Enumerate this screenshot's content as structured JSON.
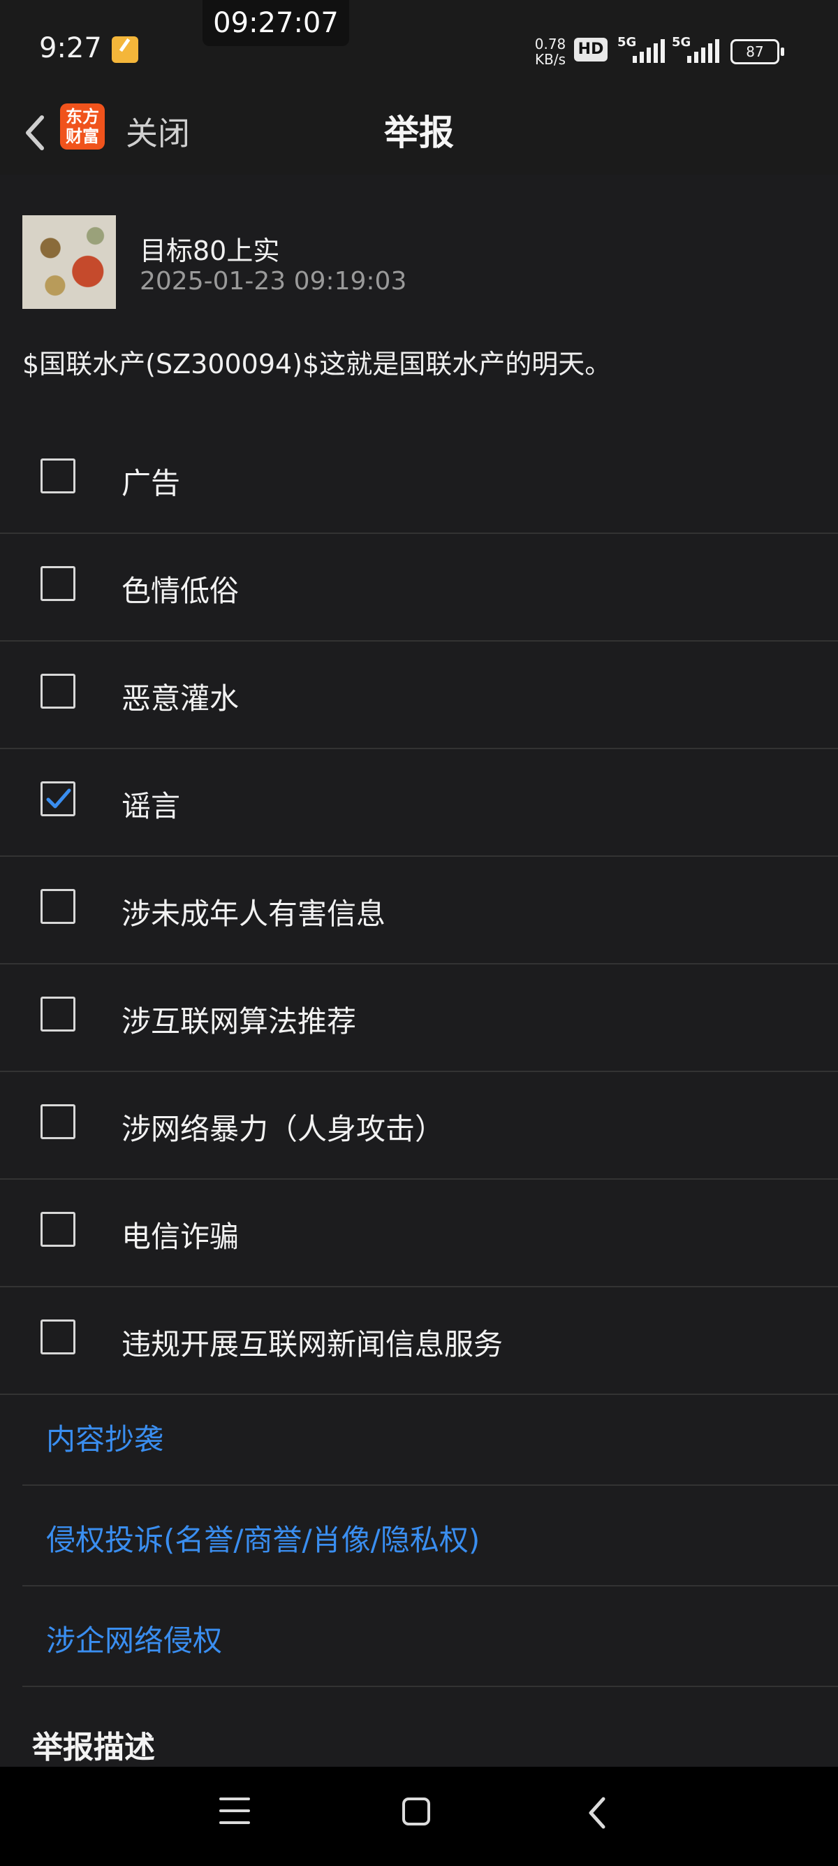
{
  "status_bar": {
    "time": "9:27",
    "floating_clock": "09:27:07",
    "net_speed_value": "0.78",
    "net_speed_unit": "KB/s",
    "hd_badge": "HD",
    "signal1_label": "5G",
    "signal2_label": "5G",
    "battery": "87"
  },
  "header": {
    "close_label": "关闭",
    "title": "举报",
    "logo_line1": "东方",
    "logo_line2": "财富"
  },
  "post": {
    "author": "目标80上实",
    "time": "2025-01-23 09:19:03",
    "content": "$国联水产(SZ300094)$这就是国联水产的明天。"
  },
  "report_options": [
    {
      "label": "广告",
      "checked": false
    },
    {
      "label": "色情低俗",
      "checked": false
    },
    {
      "label": "恶意灌水",
      "checked": false
    },
    {
      "label": "谣言",
      "checked": true
    },
    {
      "label": "涉未成年人有害信息",
      "checked": false
    },
    {
      "label": "涉互联网算法推荐",
      "checked": false
    },
    {
      "label": "涉网络暴力（人身攻击）",
      "checked": false
    },
    {
      "label": "电信诈骗",
      "checked": false
    },
    {
      "label": "违规开展互联网新闻信息服务",
      "checked": false
    }
  ],
  "links": [
    {
      "label": "内容抄袭"
    },
    {
      "label": "侵权投诉(名誉/商誉/肖像/隐私权)"
    },
    {
      "label": "涉企网络侵权"
    }
  ],
  "description_title": "举报描述",
  "colors": {
    "background": "#1c1c1e",
    "link": "#3a8ef0",
    "check": "#3a8ef0",
    "logo": "#f0531c"
  }
}
